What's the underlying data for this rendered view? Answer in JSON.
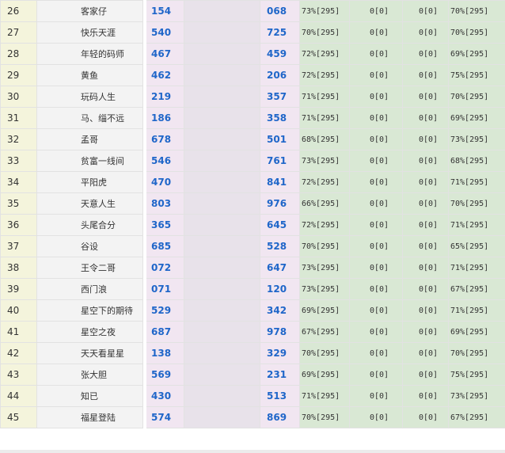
{
  "colors": {
    "value_text": "#1f66c9",
    "rank_bg": "#f4f4dc",
    "name_bg": "#f3f3f3",
    "value_bg": "#f1e6f1",
    "stat_bg": "#d9e8d4"
  },
  "rows": [
    {
      "rank": "26",
      "name": "客家仔",
      "v1": "154",
      "v2": "068",
      "s1": "73%[295]",
      "s2": "0[0]",
      "s3": "0[0]",
      "s4": "70%[295]"
    },
    {
      "rank": "27",
      "name": "快乐天涯",
      "v1": "540",
      "v2": "725",
      "s1": "70%[295]",
      "s2": "0[0]",
      "s3": "0[0]",
      "s4": "70%[295]"
    },
    {
      "rank": "28",
      "name": "年轻的码师",
      "v1": "467",
      "v2": "459",
      "s1": "72%[295]",
      "s2": "0[0]",
      "s3": "0[0]",
      "s4": "69%[295]"
    },
    {
      "rank": "29",
      "name": "黄鱼",
      "v1": "462",
      "v2": "206",
      "s1": "72%[295]",
      "s2": "0[0]",
      "s3": "0[0]",
      "s4": "75%[295]"
    },
    {
      "rank": "30",
      "name": "玩码人生",
      "v1": "219",
      "v2": "357",
      "s1": "71%[295]",
      "s2": "0[0]",
      "s3": "0[0]",
      "s4": "70%[295]"
    },
    {
      "rank": "31",
      "name": "马、缁不远",
      "v1": "186",
      "v2": "358",
      "s1": "71%[295]",
      "s2": "0[0]",
      "s3": "0[0]",
      "s4": "69%[295]"
    },
    {
      "rank": "32",
      "name": "孟哥",
      "v1": "678",
      "v2": "501",
      "s1": "68%[295]",
      "s2": "0[0]",
      "s3": "0[0]",
      "s4": "73%[295]"
    },
    {
      "rank": "33",
      "name": "贫富一线间",
      "v1": "546",
      "v2": "761",
      "s1": "73%[295]",
      "s2": "0[0]",
      "s3": "0[0]",
      "s4": "68%[295]"
    },
    {
      "rank": "34",
      "name": "平阳虎",
      "v1": "470",
      "v2": "841",
      "s1": "72%[295]",
      "s2": "0[0]",
      "s3": "0[0]",
      "s4": "71%[295]"
    },
    {
      "rank": "35",
      "name": "天意人生",
      "v1": "803",
      "v2": "976",
      "s1": "66%[295]",
      "s2": "0[0]",
      "s3": "0[0]",
      "s4": "70%[295]"
    },
    {
      "rank": "36",
      "name": "头尾合分",
      "v1": "365",
      "v2": "645",
      "s1": "72%[295]",
      "s2": "0[0]",
      "s3": "0[0]",
      "s4": "71%[295]"
    },
    {
      "rank": "37",
      "name": "谷设",
      "v1": "685",
      "v2": "528",
      "s1": "70%[295]",
      "s2": "0[0]",
      "s3": "0[0]",
      "s4": "65%[295]"
    },
    {
      "rank": "38",
      "name": "王令二哥",
      "v1": "072",
      "v2": "647",
      "s1": "73%[295]",
      "s2": "0[0]",
      "s3": "0[0]",
      "s4": "71%[295]"
    },
    {
      "rank": "39",
      "name": "西门浪",
      "v1": "071",
      "v2": "120",
      "s1": "73%[295]",
      "s2": "0[0]",
      "s3": "0[0]",
      "s4": "67%[295]"
    },
    {
      "rank": "40",
      "name": "星空下的期待",
      "v1": "529",
      "v2": "342",
      "s1": "69%[295]",
      "s2": "0[0]",
      "s3": "0[0]",
      "s4": "71%[295]"
    },
    {
      "rank": "41",
      "name": "星空之夜",
      "v1": "687",
      "v2": "978",
      "s1": "67%[295]",
      "s2": "0[0]",
      "s3": "0[0]",
      "s4": "69%[295]"
    },
    {
      "rank": "42",
      "name": "天天看星星",
      "v1": "138",
      "v2": "329",
      "s1": "70%[295]",
      "s2": "0[0]",
      "s3": "0[0]",
      "s4": "70%[295]"
    },
    {
      "rank": "43",
      "name": "张大胆",
      "v1": "569",
      "v2": "231",
      "s1": "69%[295]",
      "s2": "0[0]",
      "s3": "0[0]",
      "s4": "75%[295]"
    },
    {
      "rank": "44",
      "name": "知已",
      "v1": "430",
      "v2": "513",
      "s1": "71%[295]",
      "s2": "0[0]",
      "s3": "0[0]",
      "s4": "73%[295]"
    },
    {
      "rank": "45",
      "name": "福星登陆",
      "v1": "574",
      "v2": "869",
      "s1": "70%[295]",
      "s2": "0[0]",
      "s3": "0[0]",
      "s4": "67%[295]"
    }
  ]
}
